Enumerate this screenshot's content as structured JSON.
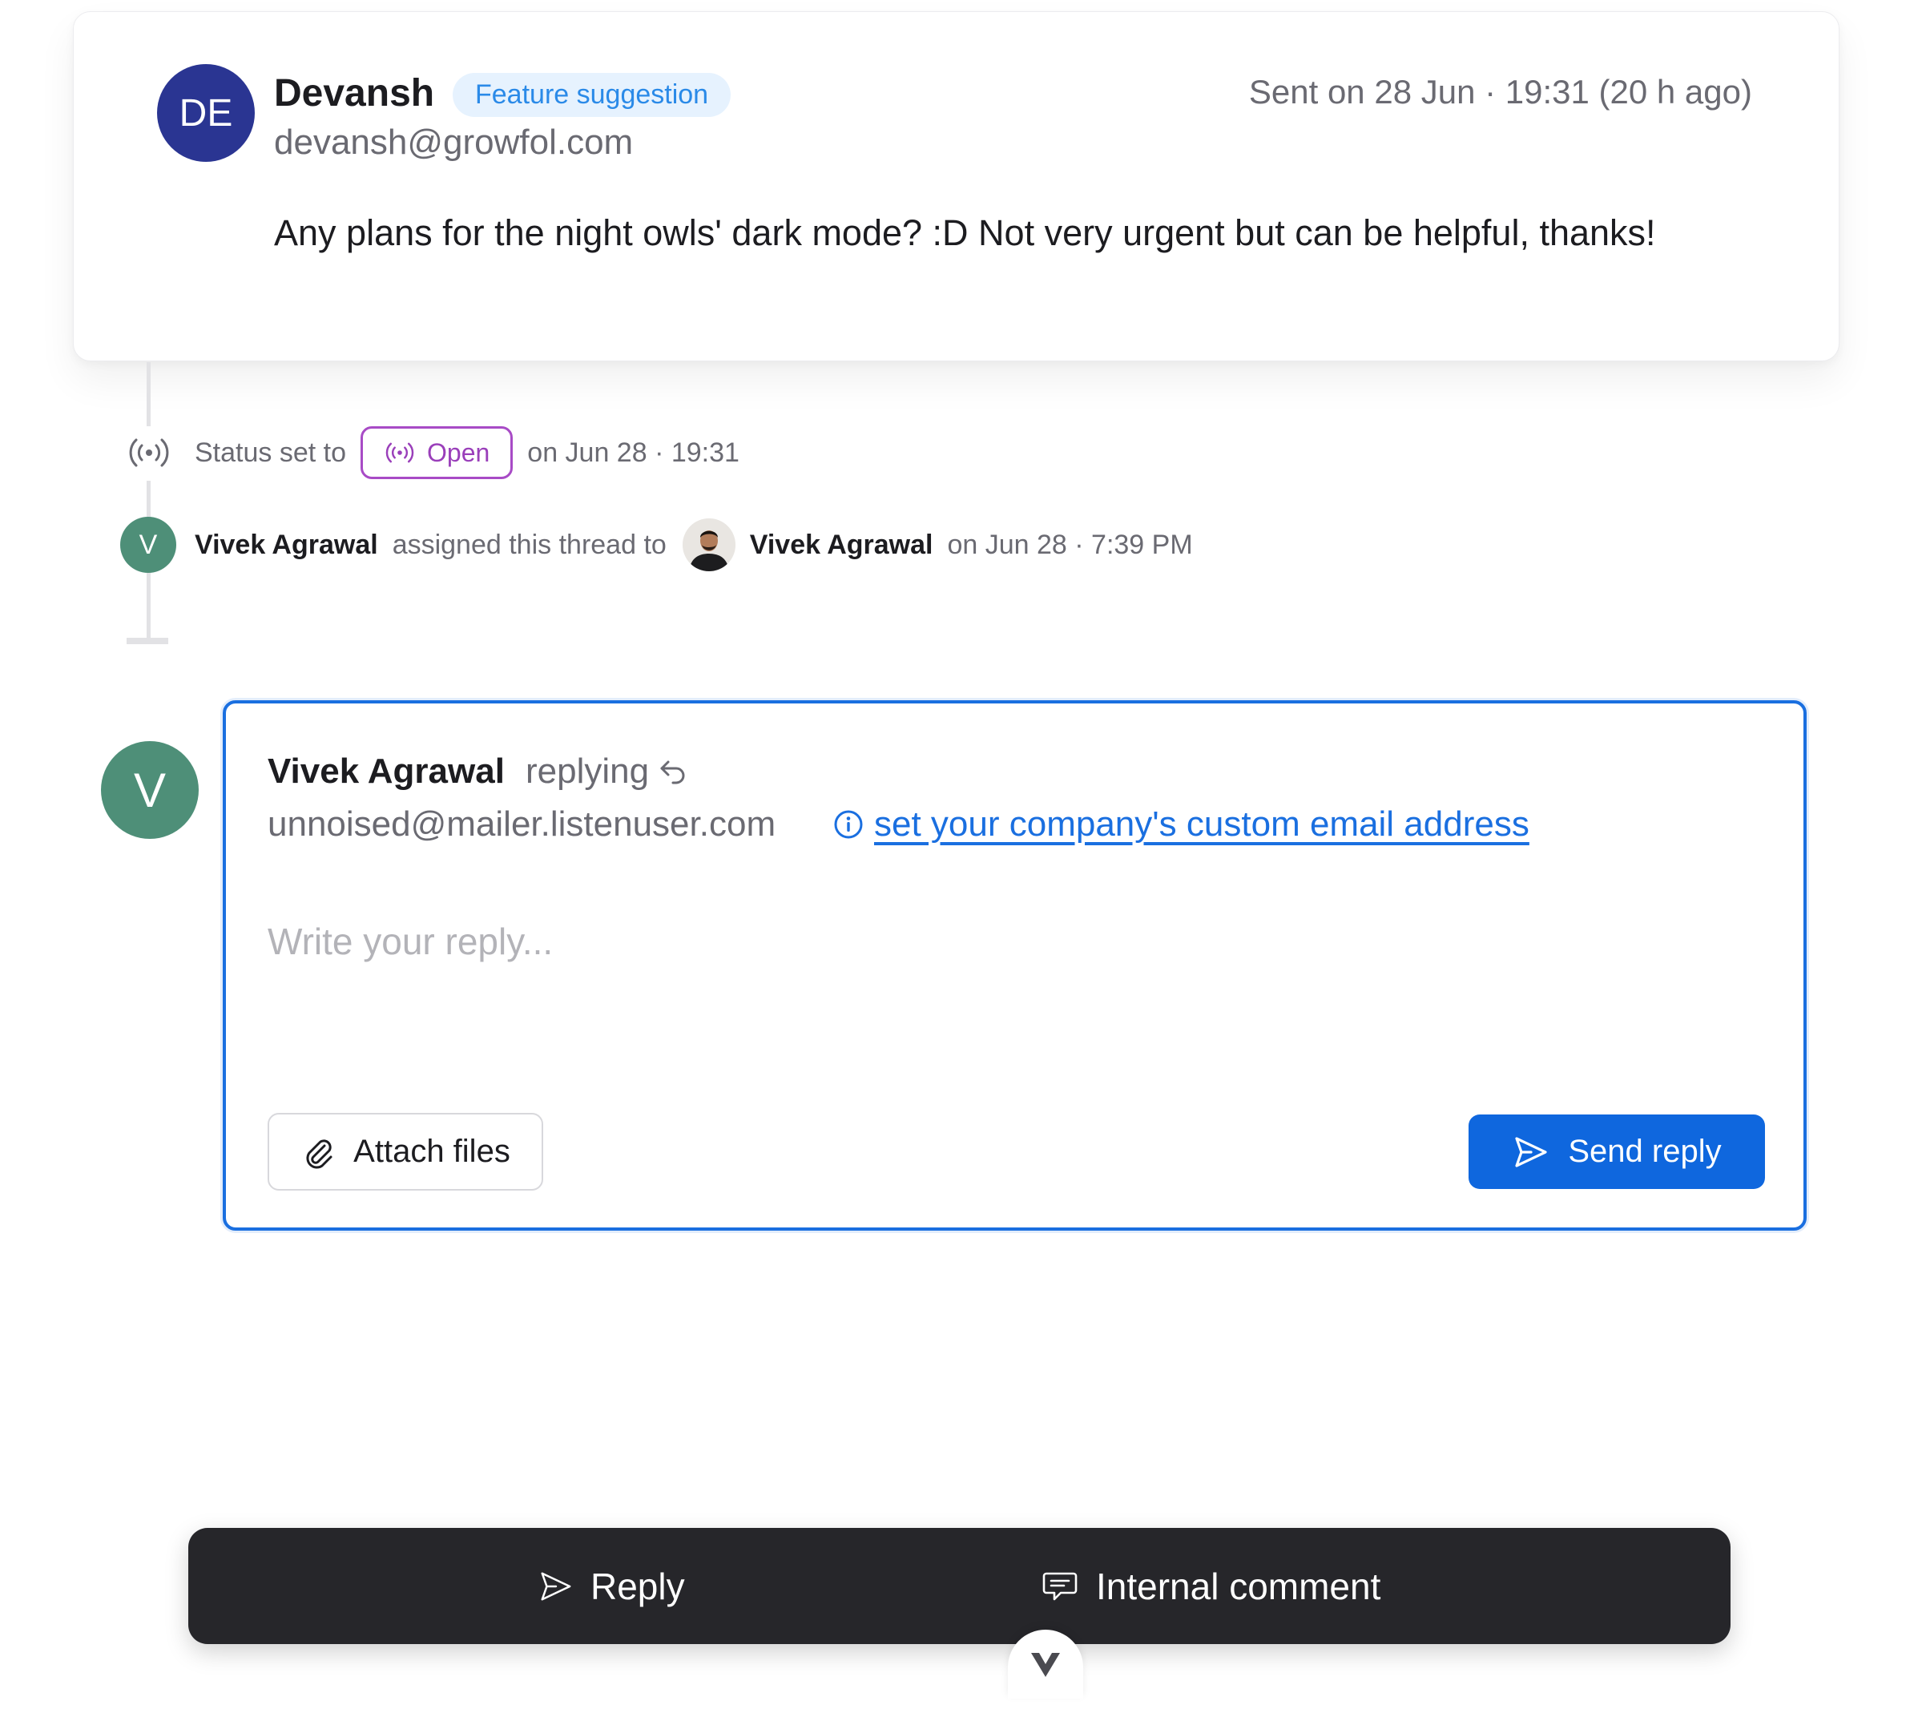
{
  "message": {
    "sender_initials": "DE",
    "sender_name": "Devansh",
    "tag": "Feature suggestion",
    "sender_email": "devansh@growfol.com",
    "sent_on": "Sent on 28 Jun · 19:31 (20 h ago)",
    "body": "Any plans for the night owls' dark mode? :D Not very urgent but can be helpful, thanks!"
  },
  "timeline": {
    "status_event": {
      "prefix": "Status set to",
      "status": "Open",
      "suffix": "on Jun 28 · 19:31"
    },
    "assign_event": {
      "actor_initial": "V",
      "actor": "Vivek Agrawal",
      "action": "assigned this thread to",
      "assignee": "Vivek Agrawal",
      "suffix": "on Jun 28 · 7:39 PM"
    }
  },
  "composer": {
    "avatar_initial": "V",
    "author": "Vivek Agrawal",
    "status": "replying",
    "from_email": "unnoised@mailer.listenuser.com",
    "custom_email_link": "set your company's custom email address",
    "placeholder": "Write your reply...",
    "attach_label": "Attach files",
    "send_label": "Send reply"
  },
  "action_bar": {
    "reply_label": "Reply",
    "comment_label": "Internal comment"
  },
  "colors": {
    "accent": "#0f67de",
    "avatar_de": "#2a3592",
    "avatar_v": "#4e8f78",
    "status_open": "#9a3fba",
    "tag_bg": "#e6f2fe",
    "tag_text": "#2a8ae8",
    "bar_bg": "#26262a"
  }
}
